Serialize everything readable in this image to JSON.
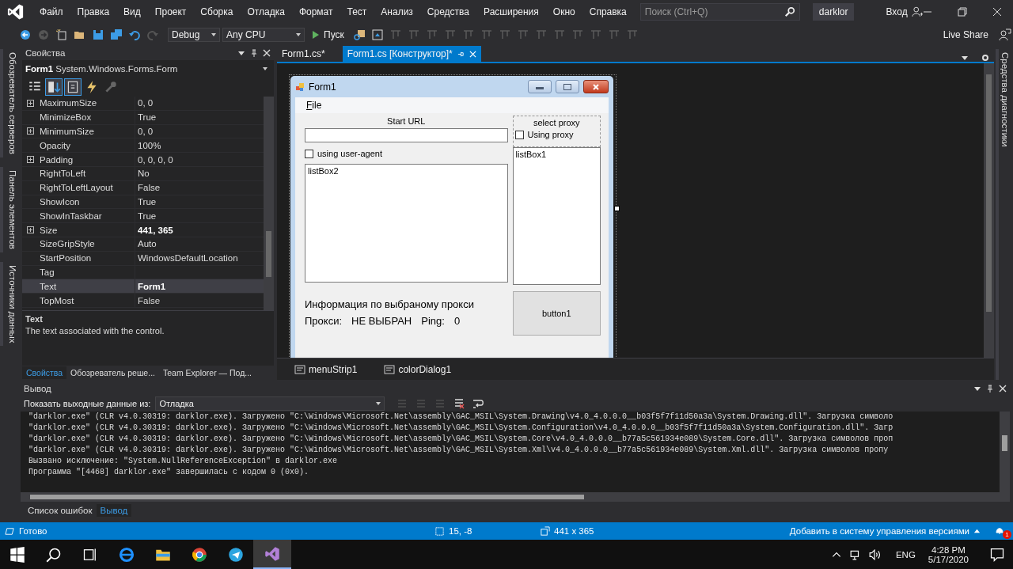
{
  "menu": [
    "Файл",
    "Правка",
    "Вид",
    "Проект",
    "Сборка",
    "Отладка",
    "Формат",
    "Тест",
    "Анализ",
    "Средства",
    "Расширения",
    "Окно",
    "Справка"
  ],
  "search": {
    "placeholder": "Поиск (Ctrl+Q)"
  },
  "solution_name": "darklor",
  "sign_in": "Вход",
  "toolbar": {
    "configuration": "Debug",
    "platform": "Any CPU",
    "run": "Пуск",
    "live_share": "Live Share"
  },
  "left_side_tabs": [
    "Обозреватель серверов",
    "Панель элементов",
    "Источники данных"
  ],
  "right_side_tab": "Средства диагностики",
  "properties": {
    "title": "Свойства",
    "object_name": "Form1",
    "object_type": "System.Windows.Forms.Form",
    "rows": [
      {
        "name": "MaximumSize",
        "value": "0, 0",
        "expandable": true,
        "bold": false,
        "selected": false
      },
      {
        "name": "MinimizeBox",
        "value": "True",
        "expandable": false,
        "bold": false,
        "selected": false
      },
      {
        "name": "MinimumSize",
        "value": "0, 0",
        "expandable": true,
        "bold": false,
        "selected": false
      },
      {
        "name": "Opacity",
        "value": "100%",
        "expandable": false,
        "bold": false,
        "selected": false
      },
      {
        "name": "Padding",
        "value": "0, 0, 0, 0",
        "expandable": true,
        "bold": false,
        "selected": false
      },
      {
        "name": "RightToLeft",
        "value": "No",
        "expandable": false,
        "bold": false,
        "selected": false
      },
      {
        "name": "RightToLeftLayout",
        "value": "False",
        "expandable": false,
        "bold": false,
        "selected": false
      },
      {
        "name": "ShowIcon",
        "value": "True",
        "expandable": false,
        "bold": false,
        "selected": false
      },
      {
        "name": "ShowInTaskbar",
        "value": "True",
        "expandable": false,
        "bold": false,
        "selected": false
      },
      {
        "name": "Size",
        "value": "441, 365",
        "expandable": true,
        "bold": true,
        "selected": false
      },
      {
        "name": "SizeGripStyle",
        "value": "Auto",
        "expandable": false,
        "bold": false,
        "selected": false
      },
      {
        "name": "StartPosition",
        "value": "WindowsDefaultLocation",
        "expandable": false,
        "bold": false,
        "selected": false
      },
      {
        "name": "Tag",
        "expandable": false,
        "selected": false
      },
      {
        "name": "Text",
        "value": "Form1",
        "expandable": false,
        "bold": true,
        "selected": true
      },
      {
        "name": "TopMost",
        "value": "False",
        "expandable": false,
        "bold": false,
        "selected": false
      }
    ],
    "description_title": "Text",
    "description": "The text associated with the control.",
    "tabs": [
      {
        "label": "Свойства",
        "selected": true
      },
      {
        "label": "Обозреватель реше...",
        "selected": false
      },
      {
        "label": "Team Explorer — Под...",
        "selected": false
      }
    ]
  },
  "doc_tabs": [
    {
      "label": "Form1.cs*",
      "selected": false
    },
    {
      "label": "Form1.cs [Конструктор]*",
      "selected": true
    }
  ],
  "form": {
    "title": "Form1",
    "menu": "File",
    "url_label": "Start URL",
    "user_agent": {
      "label": "using user-agent",
      "checked": false
    },
    "list_left": "listBox2",
    "proxy_group": "select proxy",
    "using_proxy": {
      "label": "Using proxy",
      "checked": false
    },
    "list_right": "listBox1",
    "info": "Информация по выбраному прокси",
    "proxy_label": "Прокси:",
    "proxy_value": "НЕ ВЫБРАН",
    "ping_label": "Ping:",
    "ping_value": "0",
    "button": "button1"
  },
  "components": [
    "menuStrip1",
    "colorDialog1"
  ],
  "output": {
    "title": "Вывод",
    "source_label": "Показать выходные данные из:",
    "source": "Отладка",
    "lines": [
      "\"darklor.exe\" (CLR v4.0.30319: darklor.exe). Загружено \"C:\\Windows\\Microsoft.Net\\assembly\\GAC_MSIL\\System.Drawing\\v4.0_4.0.0.0__b03f5f7f11d50a3a\\System.Drawing.dll\". Загрузка символо",
      "\"darklor.exe\" (CLR v4.0.30319: darklor.exe). Загружено \"C:\\Windows\\Microsoft.Net\\assembly\\GAC_MSIL\\System.Configuration\\v4.0_4.0.0.0__b03f5f7f11d50a3a\\System.Configuration.dll\". Загр",
      "\"darklor.exe\" (CLR v4.0.30319: darklor.exe). Загружено \"C:\\Windows\\Microsoft.Net\\assembly\\GAC_MSIL\\System.Core\\v4.0_4.0.0.0__b77a5c561934e089\\System.Core.dll\". Загрузка символов проп",
      "\"darklor.exe\" (CLR v4.0.30319: darklor.exe). Загружено \"C:\\Windows\\Microsoft.Net\\assembly\\GAC_MSIL\\System.Xml\\v4.0_4.0.0.0__b77a5c561934e089\\System.Xml.dll\". Загрузка символов пропу",
      "Вызвано исключение: \"System.NullReferenceException\" в darklor.exe",
      "Программа \"[4468] darklor.exe\" завершилась с кодом 0 (0x0)."
    ]
  },
  "bottom_tabs": [
    {
      "label": "Список ошибок",
      "selected": false
    },
    {
      "label": "Вывод",
      "selected": true
    }
  ],
  "status": {
    "text": "Готово",
    "position": "15, -8",
    "size": "441 x 365",
    "source_control": "Добавить в систему управления версиями",
    "notifications": "1"
  },
  "taskbar": {
    "language": "ENG",
    "time": "4:28 PM",
    "date": "5/17/2020"
  }
}
